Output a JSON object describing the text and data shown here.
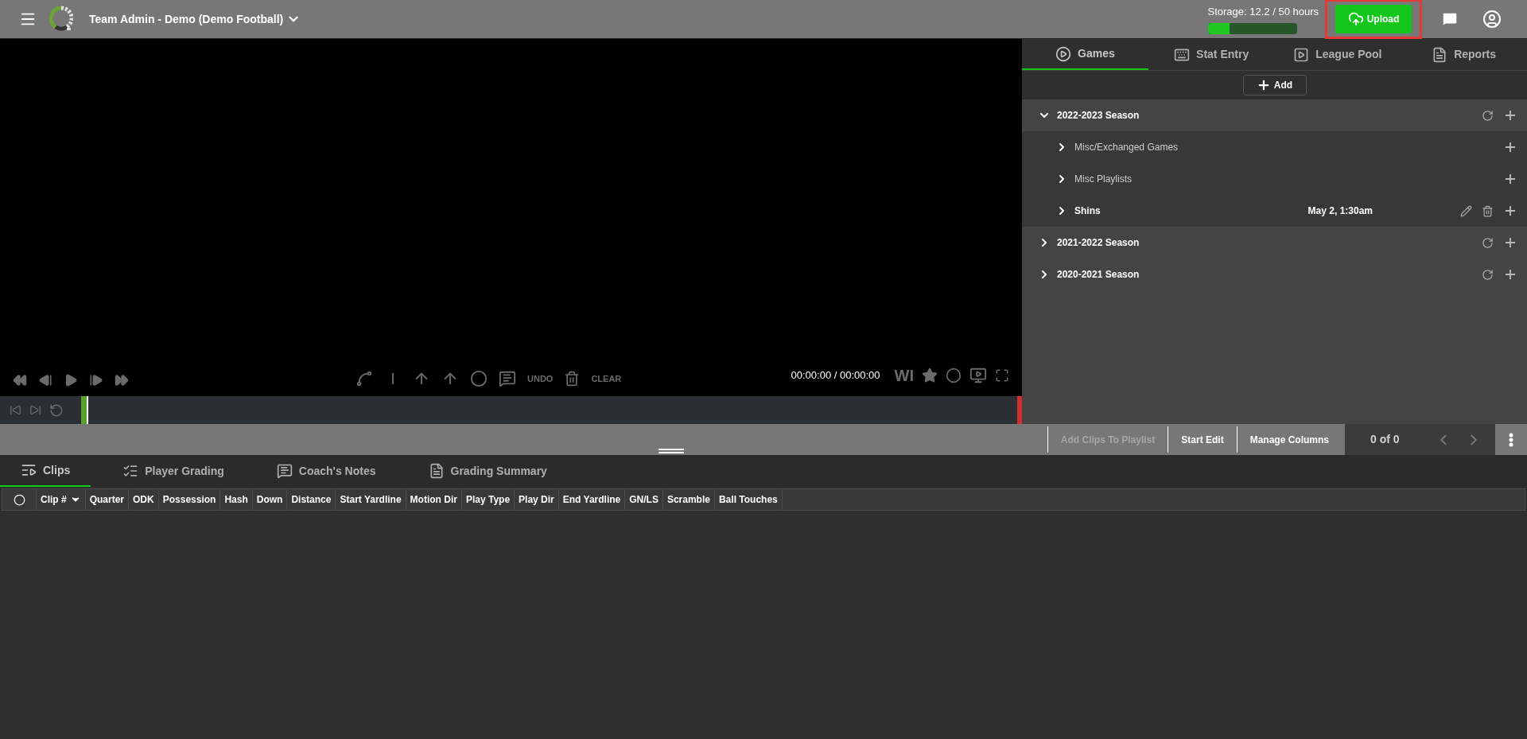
{
  "header": {
    "title": "Team Admin - Demo (Demo Football)",
    "storage": {
      "label": "Storage: 12.2 / 50 hours",
      "level": 0.244
    },
    "upload": {
      "label": "Upload",
      "highlighted": true
    }
  },
  "video": {
    "undo": "UNDO",
    "clear": "CLEAR",
    "time": "00:00:00 / 00:00:00",
    "wi": "WI"
  },
  "side_tabs": [
    {
      "label": "Games",
      "selected": true
    },
    {
      "label": "Stat Entry",
      "selected": false
    },
    {
      "label": "League Pool",
      "selected": false
    },
    {
      "label": "Reports",
      "selected": false
    }
  ],
  "add_button": "Add",
  "tree": [
    {
      "kind": "season",
      "label": "2022-2023 Season",
      "expanded": true,
      "children": [
        {
          "kind": "folder",
          "label": "Misc/Exchanged Games"
        },
        {
          "kind": "folder",
          "label": "Misc Playlists"
        },
        {
          "kind": "game",
          "label": "Shins",
          "date": "May 2, 1:30am"
        }
      ]
    },
    {
      "kind": "season",
      "label": "2021-2022 Season",
      "expanded": false
    },
    {
      "kind": "season",
      "label": "2020-2021 Season",
      "expanded": false
    }
  ],
  "toolbar": {
    "buttons": [
      {
        "label": "Add Clips To Playlist",
        "disabled": true
      },
      {
        "label": "Start Edit",
        "disabled": false
      },
      {
        "label": "Manage Columns",
        "disabled": false
      }
    ],
    "count": "0 of 0"
  },
  "bottom_tabs": [
    {
      "label": "Clips",
      "selected": true
    },
    {
      "label": "Player Grading",
      "selected": false
    },
    {
      "label": "Coach's Notes",
      "selected": false
    },
    {
      "label": "Grading Summary",
      "selected": false
    }
  ],
  "columns": [
    "Clip #",
    "Quarter",
    "ODK",
    "Possession",
    "Hash",
    "Down",
    "Distance",
    "Start Yardline",
    "Motion Dir",
    "Play Type",
    "Play Dir",
    "End Yardline",
    "GN/LS",
    "Scramble",
    "Ball Touches"
  ]
}
